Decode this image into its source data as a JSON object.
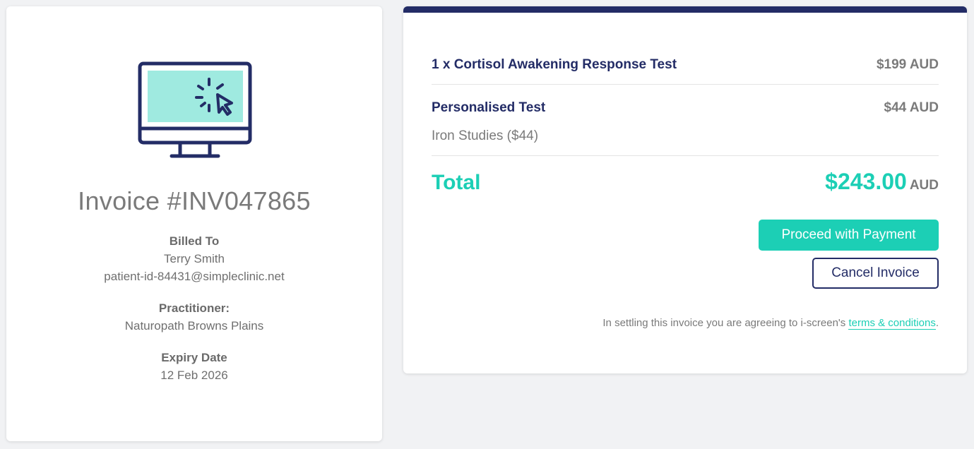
{
  "invoice": {
    "title": "Invoice #INV047865",
    "billed_to_label": "Billed To",
    "billed_to_name": "Terry Smith",
    "billed_to_email": "patient-id-84431@simpleclinic.net",
    "practitioner_label": "Practitioner:",
    "practitioner_name": "Naturopath Browns Plains",
    "expiry_label": "Expiry Date",
    "expiry_value": "12 Feb 2026",
    "icon": "computer-click-icon"
  },
  "order": {
    "items": [
      {
        "name": "1 x Cortisol Awakening Response Test",
        "price": "$199 AUD"
      },
      {
        "name": "Personalised Test",
        "price": "$44 AUD",
        "detail": "Iron Studies ($44)"
      }
    ],
    "total_label": "Total",
    "total_amount": "$243.00",
    "total_currency": "AUD",
    "pay_button_label": "Proceed with Payment",
    "cancel_button_label": "Cancel Invoice",
    "terms_prefix": "In settling this invoice you are agreeing to i-screen's ",
    "terms_link_label": "terms & conditions",
    "terms_suffix": "."
  },
  "colors": {
    "accent": "#1ccfb5",
    "navy": "#232c66",
    "muted": "#7a7a7a",
    "background": "#f1f2f4"
  }
}
